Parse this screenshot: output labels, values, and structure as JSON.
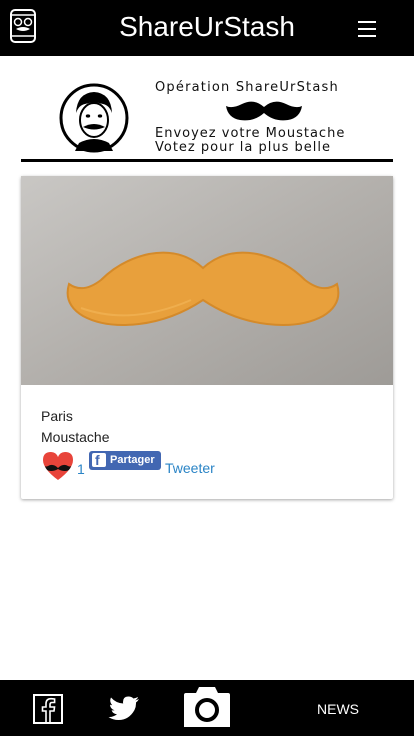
{
  "header": {
    "title": "ShareUrStash",
    "logo_icon": "phone-mustache-icon",
    "menu_icon": "menu-icon"
  },
  "banner": {
    "line1": "Opération ShareUrStash",
    "line2": "Envoyez votre Moustache",
    "line3": "Votez pour la plus belle"
  },
  "post": {
    "photo_icon": "orange-mustache-photo",
    "city": "Paris",
    "category": "Moustache",
    "likes": "1",
    "share_label": "Partager",
    "tweet_label": "Tweeter"
  },
  "bottom_nav": {
    "facebook_icon": "facebook-icon",
    "twitter_icon": "twitter-icon",
    "camera_icon": "camera-icon",
    "news_label": "NEWS"
  },
  "colors": {
    "bar": "#000000",
    "link": "#2a84c6",
    "facebook": "#4267b2",
    "heart": "#e8443a",
    "mustache": "#e8a03c"
  }
}
